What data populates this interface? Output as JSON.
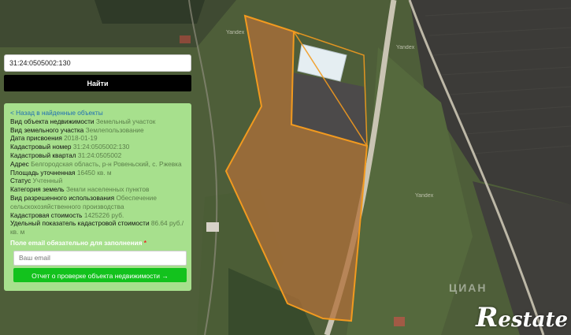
{
  "search": {
    "value": "31:24:0505002:130",
    "button_label": "Найти"
  },
  "info": {
    "back_link": "< Назад в найденные объекты",
    "rows": [
      {
        "label": "Вид объекта недвижимости",
        "value": "Земельный участок"
      },
      {
        "label": "Вид земельного участка",
        "value": "Землепользование"
      },
      {
        "label": "Дата присвоения",
        "value": "2018-01-19"
      },
      {
        "label": "Кадастровый номер",
        "value": "31:24:0505002:130"
      },
      {
        "label": "Кадастровый квартал",
        "value": "31:24:0505002"
      },
      {
        "label": "Адрес",
        "value": "Белгородская область, р-н Ровеньский, с. Ржевка"
      },
      {
        "label": "Площадь уточненная",
        "value": "16450 кв. м"
      },
      {
        "label": "Статус",
        "value": "Учтенный"
      },
      {
        "label": "Категория земель",
        "value": "Земли населенных пунктов"
      },
      {
        "label": "Вид разрешенного использования",
        "value": "Обеспечение сельскохозяйственного производства"
      },
      {
        "label": "Кадастровая стоимость",
        "value": "1425226 руб."
      },
      {
        "label": "Удельный показатель кадастровой стоимости",
        "value": "86.64 руб./кв. м"
      }
    ],
    "email_warning": "Поле email обязательно для заполнения",
    "email_warning_star": "*",
    "email_placeholder": "Ваш email",
    "report_button": "Отчет о проверке объекта недвижимости →"
  },
  "map": {
    "road_labels": [
      "Yandex",
      "Yandex",
      "Yandex"
    ],
    "watermark": "ЦИАН",
    "parcel_stroke": "#f29a1f",
    "parcel_fill": "#b0703a"
  },
  "brand": {
    "first": "R",
    "rest": "estate"
  }
}
